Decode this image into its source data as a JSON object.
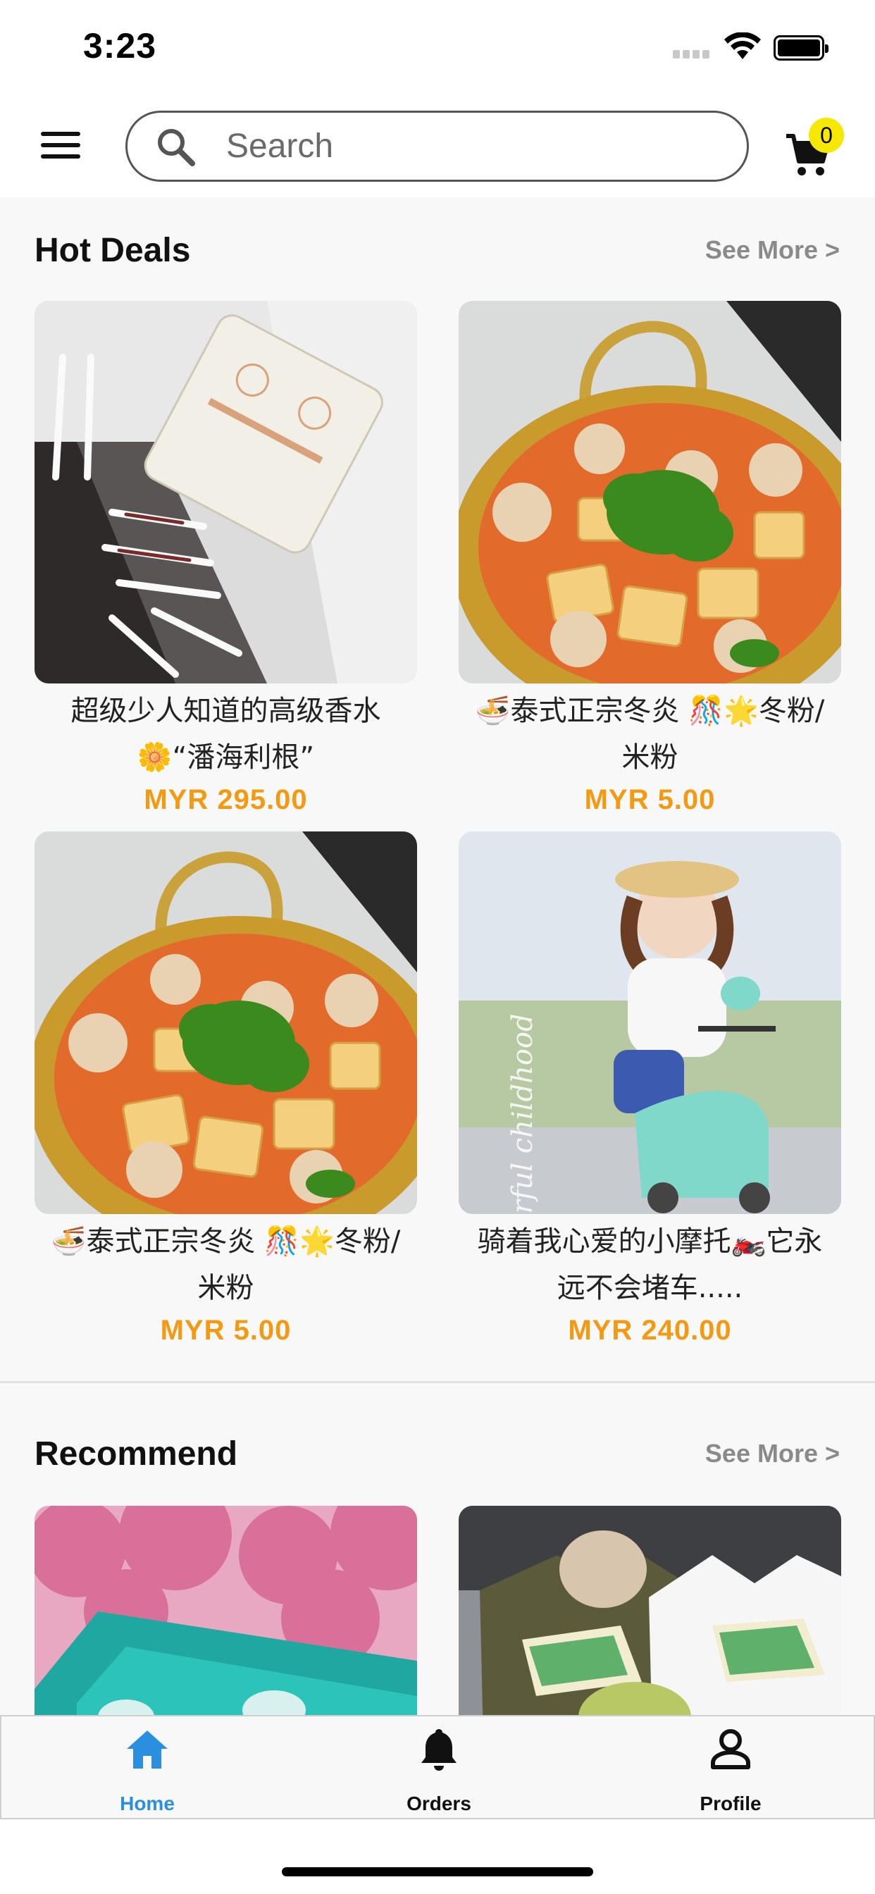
{
  "status": {
    "time": "3:23"
  },
  "search": {
    "placeholder": "Search"
  },
  "cart": {
    "count": "0"
  },
  "hot_deals": {
    "title": "Hot Deals",
    "see_more": "See More >",
    "products": [
      {
        "name": "超级少人知道的高级香水🌼“潘海利根”",
        "price": "MYR 295.00",
        "image": "perfume-box-photo"
      },
      {
        "name": "🍜泰式正宗冬炎 🎊🌟冬粉/ 米粉",
        "price": "MYR 5.00",
        "image": "tom-yum-noodle-photo"
      },
      {
        "name": "🍜泰式正宗冬炎 🎊🌟冬粉/ 米粉",
        "price": "MYR 5.00",
        "image": "tom-yum-noodle-photo"
      },
      {
        "name": "骑着我心爱的小摩托🏍️它永远不会堵车.....",
        "price": "MYR 240.00",
        "image": "child-scooter-photo",
        "image_caption": "Wonderful childhood"
      }
    ]
  },
  "recommend": {
    "title": "Recommend",
    "see_more": "See More >",
    "products": [
      {
        "image": "jewelry-box-blossom-photo"
      },
      {
        "image": "tshirt-display-photo"
      }
    ]
  },
  "tabs": [
    {
      "label": "Home",
      "icon": "home-icon",
      "active": true
    },
    {
      "label": "Orders",
      "icon": "bell-icon",
      "active": false
    },
    {
      "label": "Profile",
      "icon": "person-icon",
      "active": false
    }
  ],
  "colors": {
    "accent": "#2b8fe0",
    "price": "#f39a12",
    "badge": "#f6e800"
  }
}
